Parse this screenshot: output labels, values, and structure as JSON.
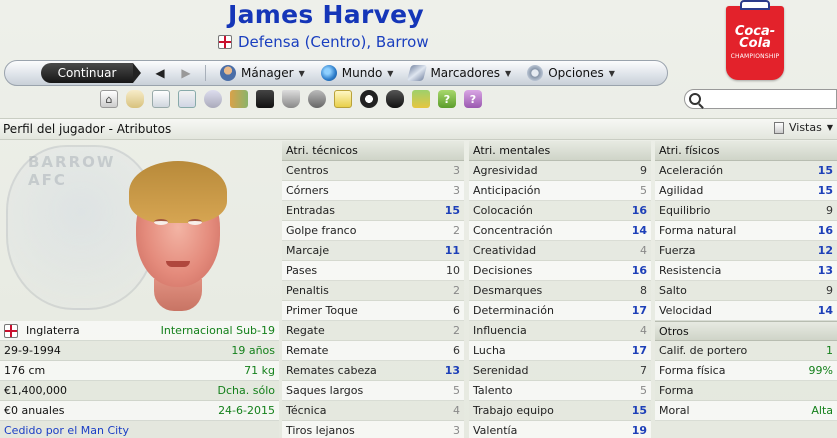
{
  "header": {
    "player_name": "James Harvey",
    "position": "Defensa (Centro), Barrow"
  },
  "sponsor": {
    "brand": "Coca-Cola",
    "line": "CHAMPIONSHIP"
  },
  "navbar": {
    "continue_label": "Continuar",
    "manager_label": "Mánager",
    "world_label": "Mundo",
    "bookmarks_label": "Marcadores",
    "options_label": "Opciones"
  },
  "search": {
    "value": ""
  },
  "breadcrumb": "Perfil del jugador - Atributos",
  "views_label": "Vistas",
  "club_crest_text": "BARROW AFC",
  "profile": {
    "nationality": "Inglaterra",
    "nationality_status": "Internacional Sub-19",
    "dob": "29-9-1994",
    "age": "19 años",
    "height": "176 cm",
    "weight": "71 kg",
    "value": "€1,400,000",
    "foot": "Dcha. sólo",
    "wage": "€0 anuales",
    "contract_end": "24-6-2015",
    "loan": "Cedido por el Man City"
  },
  "technical": {
    "title": "Atri. técnicos",
    "rows": [
      {
        "name": "Centros",
        "value": "3"
      },
      {
        "name": "Córners",
        "value": "3"
      },
      {
        "name": "Entradas",
        "value": "15"
      },
      {
        "name": "Golpe franco",
        "value": "2"
      },
      {
        "name": "Marcaje",
        "value": "11"
      },
      {
        "name": "Pases",
        "value": "10"
      },
      {
        "name": "Penaltis",
        "value": "2"
      },
      {
        "name": "Primer Toque",
        "value": "6"
      },
      {
        "name": "Regate",
        "value": "2"
      },
      {
        "name": "Remate",
        "value": "6"
      },
      {
        "name": "Remates cabeza",
        "value": "13"
      },
      {
        "name": "Saques largos",
        "value": "5"
      },
      {
        "name": "Técnica",
        "value": "4"
      },
      {
        "name": "Tiros lejanos",
        "value": "3"
      }
    ]
  },
  "mental": {
    "title": "Atri. mentales",
    "rows": [
      {
        "name": "Agresividad",
        "value": "9"
      },
      {
        "name": "Anticipación",
        "value": "5"
      },
      {
        "name": "Colocación",
        "value": "16"
      },
      {
        "name": "Concentración",
        "value": "14"
      },
      {
        "name": "Creatividad",
        "value": "4"
      },
      {
        "name": "Decisiones",
        "value": "16"
      },
      {
        "name": "Desmarques",
        "value": "8"
      },
      {
        "name": "Determinación",
        "value": "17"
      },
      {
        "name": "Influencia",
        "value": "4"
      },
      {
        "name": "Lucha",
        "value": "17"
      },
      {
        "name": "Serenidad",
        "value": "7"
      },
      {
        "name": "Talento",
        "value": "5"
      },
      {
        "name": "Trabajo equipo",
        "value": "15"
      },
      {
        "name": "Valentía",
        "value": "19"
      }
    ]
  },
  "physical": {
    "title": "Atri. físicos",
    "rows": [
      {
        "name": "Aceleración",
        "value": "15"
      },
      {
        "name": "Agilidad",
        "value": "15"
      },
      {
        "name": "Equilibrio",
        "value": "9"
      },
      {
        "name": "Forma natural",
        "value": "16"
      },
      {
        "name": "Fuerza",
        "value": "12"
      },
      {
        "name": "Resistencia",
        "value": "13"
      },
      {
        "name": "Salto",
        "value": "9"
      },
      {
        "name": "Velocidad",
        "value": "14"
      }
    ]
  },
  "other": {
    "title": "Otros",
    "rows": [
      {
        "name": "Calif. de portero",
        "value": "1"
      },
      {
        "name": "Forma física",
        "value": "99%"
      },
      {
        "name": "Forma",
        "value": ""
      },
      {
        "name": "Moral",
        "value": "Alta"
      }
    ]
  }
}
